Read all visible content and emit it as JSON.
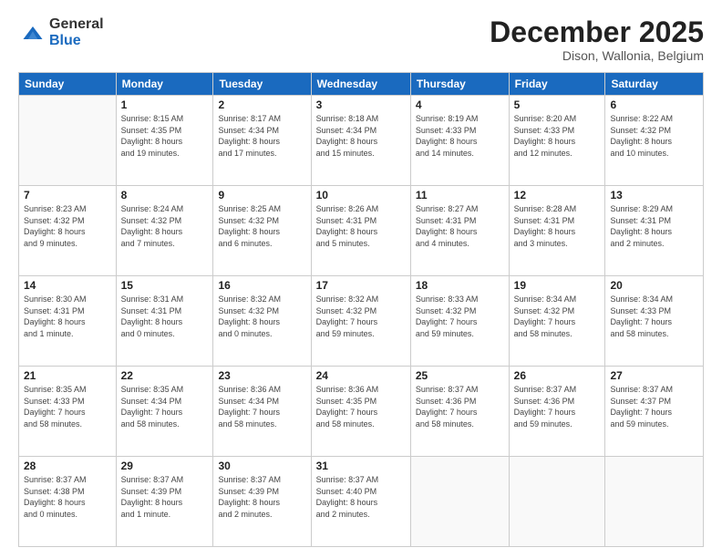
{
  "logo": {
    "general": "General",
    "blue": "Blue"
  },
  "header": {
    "month": "December 2025",
    "location": "Dison, Wallonia, Belgium"
  },
  "days_of_week": [
    "Sunday",
    "Monday",
    "Tuesday",
    "Wednesday",
    "Thursday",
    "Friday",
    "Saturday"
  ],
  "weeks": [
    [
      {
        "day": "",
        "info": ""
      },
      {
        "day": "1",
        "info": "Sunrise: 8:15 AM\nSunset: 4:35 PM\nDaylight: 8 hours\nand 19 minutes."
      },
      {
        "day": "2",
        "info": "Sunrise: 8:17 AM\nSunset: 4:34 PM\nDaylight: 8 hours\nand 17 minutes."
      },
      {
        "day": "3",
        "info": "Sunrise: 8:18 AM\nSunset: 4:34 PM\nDaylight: 8 hours\nand 15 minutes."
      },
      {
        "day": "4",
        "info": "Sunrise: 8:19 AM\nSunset: 4:33 PM\nDaylight: 8 hours\nand 14 minutes."
      },
      {
        "day": "5",
        "info": "Sunrise: 8:20 AM\nSunset: 4:33 PM\nDaylight: 8 hours\nand 12 minutes."
      },
      {
        "day": "6",
        "info": "Sunrise: 8:22 AM\nSunset: 4:32 PM\nDaylight: 8 hours\nand 10 minutes."
      }
    ],
    [
      {
        "day": "7",
        "info": "Sunrise: 8:23 AM\nSunset: 4:32 PM\nDaylight: 8 hours\nand 9 minutes."
      },
      {
        "day": "8",
        "info": "Sunrise: 8:24 AM\nSunset: 4:32 PM\nDaylight: 8 hours\nand 7 minutes."
      },
      {
        "day": "9",
        "info": "Sunrise: 8:25 AM\nSunset: 4:32 PM\nDaylight: 8 hours\nand 6 minutes."
      },
      {
        "day": "10",
        "info": "Sunrise: 8:26 AM\nSunset: 4:31 PM\nDaylight: 8 hours\nand 5 minutes."
      },
      {
        "day": "11",
        "info": "Sunrise: 8:27 AM\nSunset: 4:31 PM\nDaylight: 8 hours\nand 4 minutes."
      },
      {
        "day": "12",
        "info": "Sunrise: 8:28 AM\nSunset: 4:31 PM\nDaylight: 8 hours\nand 3 minutes."
      },
      {
        "day": "13",
        "info": "Sunrise: 8:29 AM\nSunset: 4:31 PM\nDaylight: 8 hours\nand 2 minutes."
      }
    ],
    [
      {
        "day": "14",
        "info": "Sunrise: 8:30 AM\nSunset: 4:31 PM\nDaylight: 8 hours\nand 1 minute."
      },
      {
        "day": "15",
        "info": "Sunrise: 8:31 AM\nSunset: 4:31 PM\nDaylight: 8 hours\nand 0 minutes."
      },
      {
        "day": "16",
        "info": "Sunrise: 8:32 AM\nSunset: 4:32 PM\nDaylight: 8 hours\nand 0 minutes."
      },
      {
        "day": "17",
        "info": "Sunrise: 8:32 AM\nSunset: 4:32 PM\nDaylight: 7 hours\nand 59 minutes."
      },
      {
        "day": "18",
        "info": "Sunrise: 8:33 AM\nSunset: 4:32 PM\nDaylight: 7 hours\nand 59 minutes."
      },
      {
        "day": "19",
        "info": "Sunrise: 8:34 AM\nSunset: 4:32 PM\nDaylight: 7 hours\nand 58 minutes."
      },
      {
        "day": "20",
        "info": "Sunrise: 8:34 AM\nSunset: 4:33 PM\nDaylight: 7 hours\nand 58 minutes."
      }
    ],
    [
      {
        "day": "21",
        "info": "Sunrise: 8:35 AM\nSunset: 4:33 PM\nDaylight: 7 hours\nand 58 minutes."
      },
      {
        "day": "22",
        "info": "Sunrise: 8:35 AM\nSunset: 4:34 PM\nDaylight: 7 hours\nand 58 minutes."
      },
      {
        "day": "23",
        "info": "Sunrise: 8:36 AM\nSunset: 4:34 PM\nDaylight: 7 hours\nand 58 minutes."
      },
      {
        "day": "24",
        "info": "Sunrise: 8:36 AM\nSunset: 4:35 PM\nDaylight: 7 hours\nand 58 minutes."
      },
      {
        "day": "25",
        "info": "Sunrise: 8:37 AM\nSunset: 4:36 PM\nDaylight: 7 hours\nand 58 minutes."
      },
      {
        "day": "26",
        "info": "Sunrise: 8:37 AM\nSunset: 4:36 PM\nDaylight: 7 hours\nand 59 minutes."
      },
      {
        "day": "27",
        "info": "Sunrise: 8:37 AM\nSunset: 4:37 PM\nDaylight: 7 hours\nand 59 minutes."
      }
    ],
    [
      {
        "day": "28",
        "info": "Sunrise: 8:37 AM\nSunset: 4:38 PM\nDaylight: 8 hours\nand 0 minutes."
      },
      {
        "day": "29",
        "info": "Sunrise: 8:37 AM\nSunset: 4:39 PM\nDaylight: 8 hours\nand 1 minute."
      },
      {
        "day": "30",
        "info": "Sunrise: 8:37 AM\nSunset: 4:39 PM\nDaylight: 8 hours\nand 2 minutes."
      },
      {
        "day": "31",
        "info": "Sunrise: 8:37 AM\nSunset: 4:40 PM\nDaylight: 8 hours\nand 2 minutes."
      },
      {
        "day": "",
        "info": ""
      },
      {
        "day": "",
        "info": ""
      },
      {
        "day": "",
        "info": ""
      }
    ]
  ]
}
